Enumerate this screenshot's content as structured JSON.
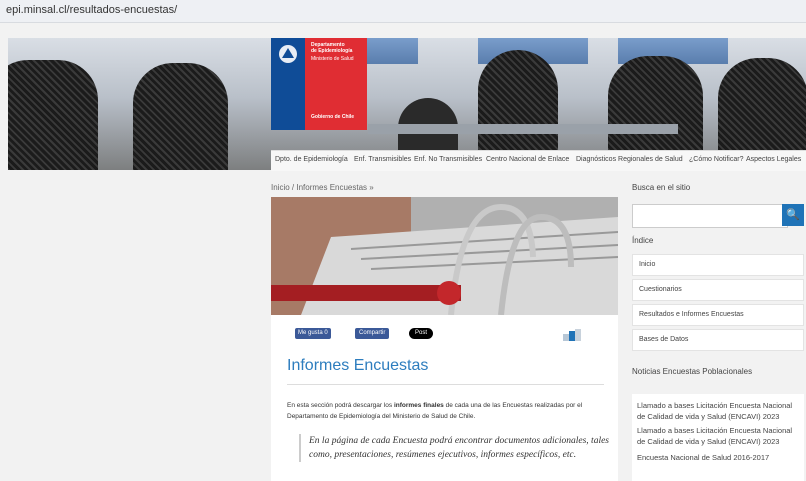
{
  "browser": {
    "url": "epi.minsal.cl/resultados-encuestas/"
  },
  "logo": {
    "line1": "Departamento",
    "line2": "de Epidemiología",
    "line3": "Ministerio de Salud",
    "footer": "Gobierno de Chile"
  },
  "nav": {
    "items": [
      "Dpto. de Epidemiología",
      "Enf. Transmisibles",
      "Enf. No Transmisibles",
      "Centro Nacional de Enlace",
      "Diagnósticos Regionales de Salud",
      "¿Cómo Notificar?",
      "Aspectos Legales"
    ]
  },
  "breadcrumb": "Inicio / Informes Encuestas »",
  "social": {
    "like": "Me gusta 0",
    "share": "Compartir",
    "post": "Post"
  },
  "main": {
    "title": "Informes Encuestas",
    "intro_parts": [
      "En esta sección podrá descargar los ",
      "informes finales",
      " de cada una de las Encuestas realizadas por el Departamento de Epidemiología del Ministerio de Salud de Chile."
    ],
    "quote": "En la página de cada Encuesta podrá encontrar documentos adicionales, tales como, presentaciones, resúmenes ejecutivos, informes específicos, etc."
  },
  "sidebar": {
    "search_title": "Busca en el sitio",
    "search_placeholder": "",
    "index_title": "Índice",
    "index_items": [
      "Inicio",
      "Cuestionarios",
      "Resultados e Informes Encuestas",
      "Bases de Datos"
    ],
    "news_title": "Noticias Encuestas Poblacionales",
    "news_items": [
      "Llamado a bases Licitación Encuesta Nacional de Calidad de vida y Salud (ENCAVI) 2023",
      "Llamado a bases Licitación Encuesta Nacional de Calidad de vida y Salud (ENCAVI) 2023",
      "Encuesta Nacional de Salud 2016-2017"
    ]
  }
}
